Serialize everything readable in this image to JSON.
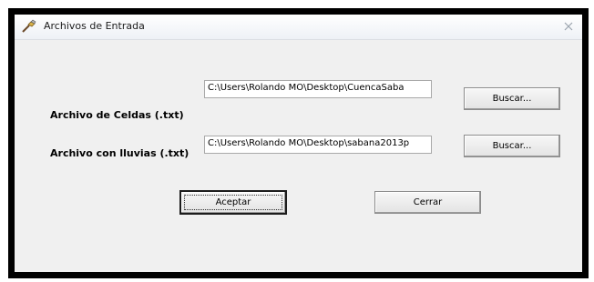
{
  "window": {
    "title": "Archivos de Entrada"
  },
  "form": {
    "celdas": {
      "label": "Archivo de Celdas (.txt)",
      "value": "C:\\Users\\Rolando MO\\Desktop\\CuencaSaba",
      "browse_label": "Buscar..."
    },
    "lluvias": {
      "label": "Archivo con lluvias (.txt)",
      "value": "C:\\Users\\Rolando MO\\Desktop\\sabana2013p",
      "browse_label": "Buscar..."
    }
  },
  "actions": {
    "accept_label": "Aceptar",
    "close_label": "Cerrar"
  },
  "icons": {
    "title": "app-tool-icon",
    "close": "close-icon"
  }
}
